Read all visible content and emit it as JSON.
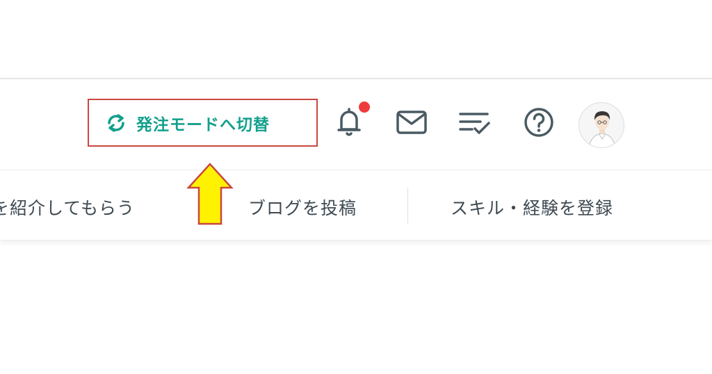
{
  "header": {
    "switch_mode_label": "発注モードへ切替",
    "icons": [
      "sync-icon",
      "bell-icon",
      "mail-icon",
      "checklist-icon",
      "help-icon"
    ],
    "notification_badge_color": "#ef3b3b",
    "accent_color": "#13a08c"
  },
  "subnav": {
    "items": [
      {
        "label": "を紹介してもらう"
      },
      {
        "label": "ブログを投稿"
      },
      {
        "label": "スキル・経験を登録"
      }
    ]
  },
  "annotation": {
    "highlight_color": "#c9473f",
    "arrow_color": "#fff200"
  }
}
